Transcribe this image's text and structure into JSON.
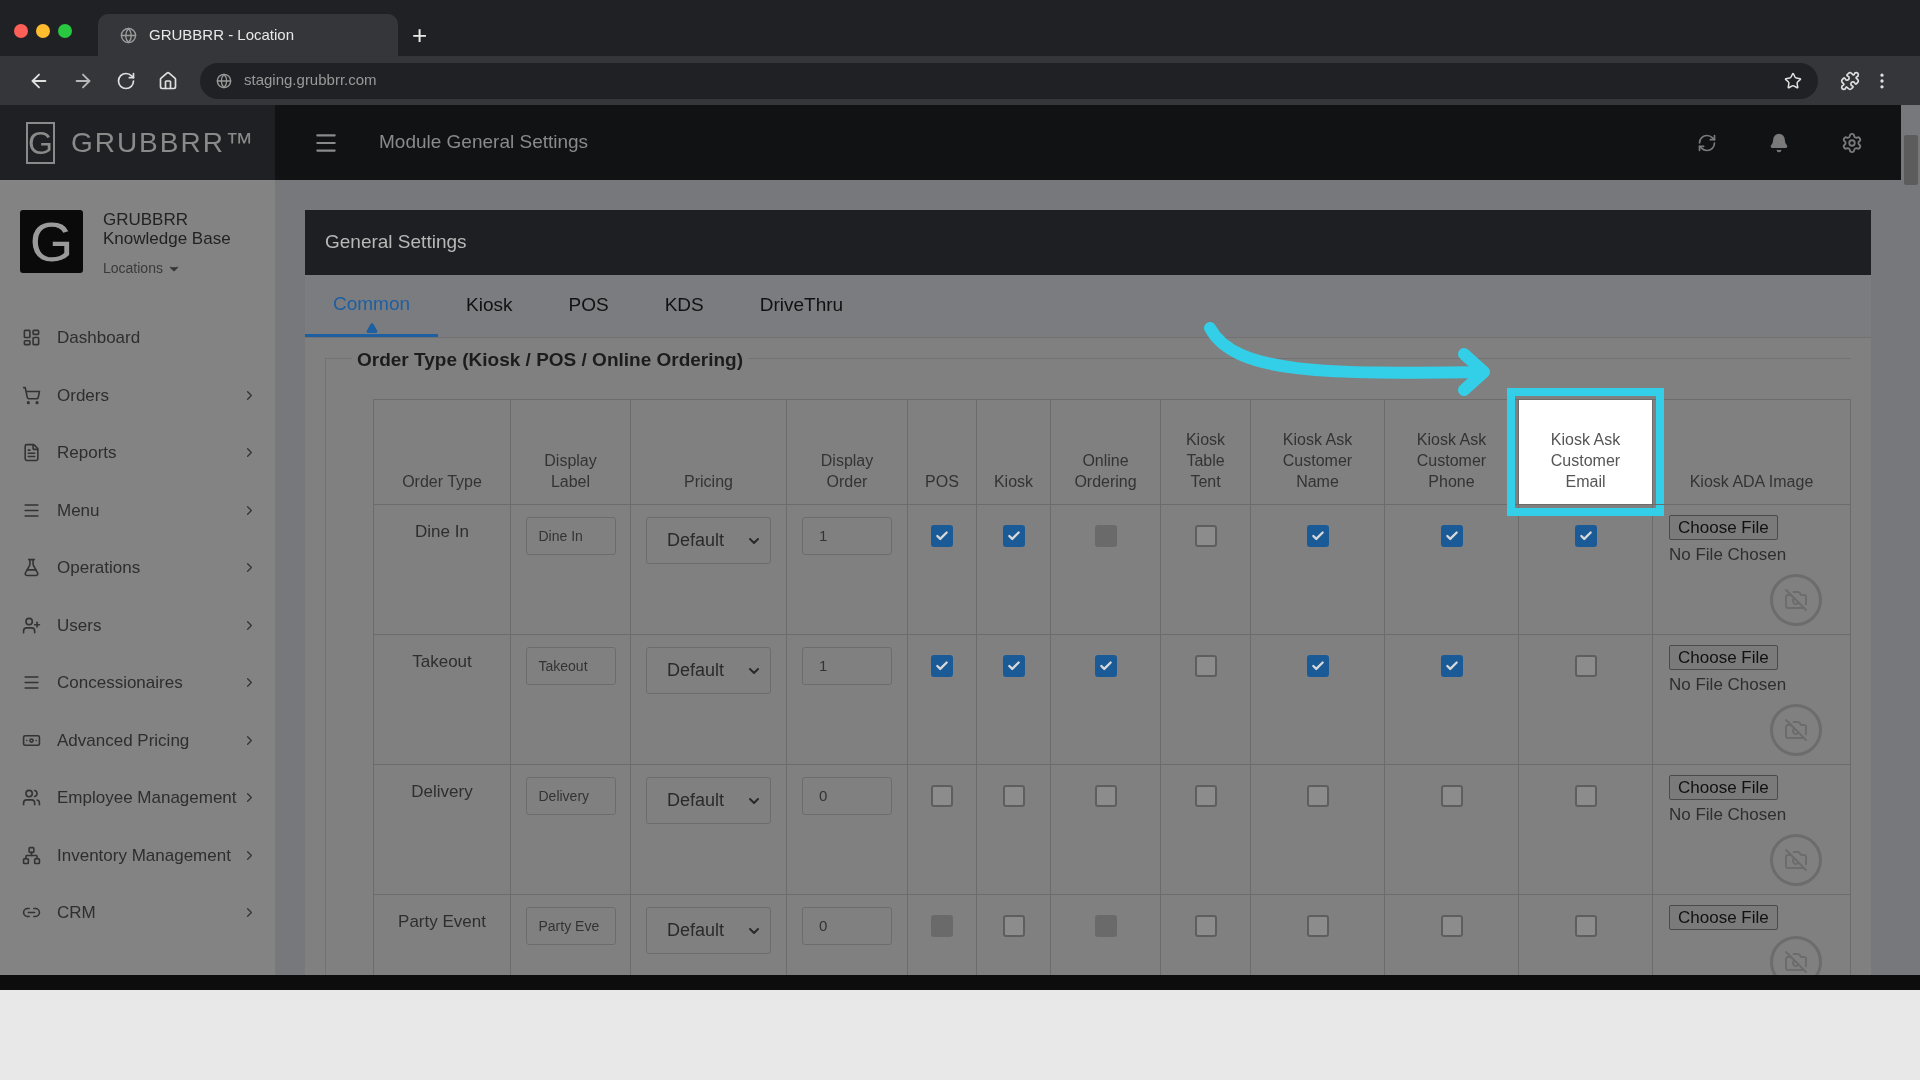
{
  "browser": {
    "tab_title": "GRUBBRR - Location",
    "new_tab": "+",
    "url": "staging.grubbrr.com"
  },
  "app": {
    "logo_mark": "G",
    "logo_name": "GRUBBRR™",
    "page_title": "Module General Settings"
  },
  "sidebar": {
    "org_mark": "G",
    "org_name": "GRUBBRR Knowledge Base",
    "location_menu": "Locations",
    "items": [
      {
        "label": "Dashboard",
        "has_submenu": false
      },
      {
        "label": "Orders",
        "has_submenu": true
      },
      {
        "label": "Reports",
        "has_submenu": true
      },
      {
        "label": "Menu",
        "has_submenu": true
      },
      {
        "label": "Operations",
        "has_submenu": true
      },
      {
        "label": "Users",
        "has_submenu": true
      },
      {
        "label": "Concessionaires",
        "has_submenu": true
      },
      {
        "label": "Advanced Pricing",
        "has_submenu": true
      },
      {
        "label": "Employee Management",
        "has_submenu": true
      },
      {
        "label": "Inventory Management",
        "has_submenu": true
      },
      {
        "label": "CRM",
        "has_submenu": true
      }
    ]
  },
  "panel": {
    "title": "General Settings",
    "tabs": [
      {
        "label": "Common",
        "selected": true
      },
      {
        "label": "Kiosk",
        "selected": false
      },
      {
        "label": "POS",
        "selected": false
      },
      {
        "label": "KDS",
        "selected": false
      },
      {
        "label": "DriveThru",
        "selected": false
      }
    ],
    "section": {
      "legend": "Order Type (Kiosk / POS / Online Ordering)",
      "columns": [
        {
          "label": "Order Type",
          "highlighted": false
        },
        {
          "label": "Display Label",
          "highlighted": false
        },
        {
          "label": "Pricing",
          "highlighted": false
        },
        {
          "label": "Display Order",
          "highlighted": false
        },
        {
          "label": "POS",
          "highlighted": false
        },
        {
          "label": "Kiosk",
          "highlighted": false
        },
        {
          "label": "Online Ordering",
          "highlighted": false
        },
        {
          "label": "Kiosk Table Tent",
          "highlighted": false
        },
        {
          "label": "Kiosk Ask Customer Name",
          "highlighted": false
        },
        {
          "label": "Kiosk Ask Customer Phone",
          "highlighted": false
        },
        {
          "label": "Kiosk Ask Customer Email",
          "highlighted": true
        },
        {
          "label": "Kiosk ADA Image",
          "highlighted": false
        }
      ],
      "rows": [
        {
          "order_type": "Dine In",
          "display_label": "Dine In",
          "pricing": "Default",
          "display_order": "1",
          "flags": [
            {
              "checked": true,
              "disabled": false
            },
            {
              "checked": true,
              "disabled": false
            },
            {
              "checked": false,
              "disabled": true
            },
            {
              "checked": false,
              "disabled": false
            },
            {
              "checked": true,
              "disabled": false
            },
            {
              "checked": true,
              "disabled": false
            },
            {
              "checked": true,
              "disabled": false
            }
          ],
          "file_button": "Choose File",
          "file_status": "No File Chosen"
        },
        {
          "order_type": "Takeout",
          "display_label": "Takeout",
          "pricing": "Default",
          "display_order": "1",
          "flags": [
            {
              "checked": true,
              "disabled": false
            },
            {
              "checked": true,
              "disabled": false
            },
            {
              "checked": true,
              "disabled": false
            },
            {
              "checked": false,
              "disabled": false
            },
            {
              "checked": true,
              "disabled": false
            },
            {
              "checked": true,
              "disabled": false
            },
            {
              "checked": false,
              "disabled": false
            }
          ],
          "file_button": "Choose File",
          "file_status": "No File Chosen"
        },
        {
          "order_type": "Delivery",
          "display_label": "Delivery",
          "pricing": "Default",
          "display_order": "0",
          "flags": [
            {
              "checked": false,
              "disabled": false
            },
            {
              "checked": false,
              "disabled": false
            },
            {
              "checked": false,
              "disabled": false
            },
            {
              "checked": false,
              "disabled": false
            },
            {
              "checked": false,
              "disabled": false
            },
            {
              "checked": false,
              "disabled": false
            },
            {
              "checked": false,
              "disabled": false
            }
          ],
          "file_button": "Choose File",
          "file_status": "No File Chosen"
        },
        {
          "order_type": "Party Event",
          "display_label": "Party Eve",
          "pricing": "Default",
          "display_order": "0",
          "flags": [
            {
              "checked": false,
              "disabled": true
            },
            {
              "checked": false,
              "disabled": false
            },
            {
              "checked": false,
              "disabled": true
            },
            {
              "checked": false,
              "disabled": false
            },
            {
              "checked": false,
              "disabled": false
            },
            {
              "checked": false,
              "disabled": false
            },
            {
              "checked": false,
              "disabled": false
            }
          ],
          "file_button": "Choose File"
        }
      ]
    }
  }
}
